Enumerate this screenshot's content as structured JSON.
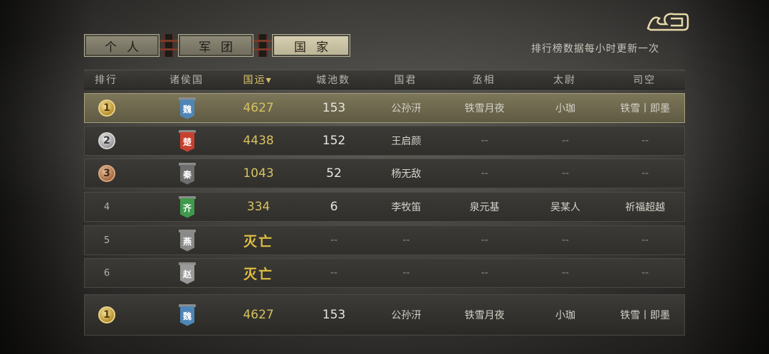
{
  "tabs": [
    "个人",
    "军团",
    "国家"
  ],
  "active_tab": 2,
  "notice": "排行榜数据每小时更新一次",
  "headers": {
    "rank": "排行",
    "state": "诸侯国",
    "luck": "国运▾",
    "cities": "城池数",
    "king": "国君",
    "chancellor": "丞相",
    "taiwei": "太尉",
    "sikong": "司空"
  },
  "rows": [
    {
      "rank": "1",
      "state": "魏",
      "luck": "4627",
      "cities": "153",
      "king": "公孙汧",
      "chancellor": "铁雪月夜",
      "taiwei": "小珈",
      "sikong": "铁雪丨即墨"
    },
    {
      "rank": "2",
      "state": "楚",
      "luck": "4438",
      "cities": "152",
      "king": "王启颜",
      "chancellor": "--",
      "taiwei": "--",
      "sikong": "--"
    },
    {
      "rank": "3",
      "state": "秦",
      "luck": "1043",
      "cities": "52",
      "king": "杨无敌",
      "chancellor": "--",
      "taiwei": "--",
      "sikong": "--"
    },
    {
      "rank": "4",
      "state": "齐",
      "luck": "334",
      "cities": "6",
      "king": "李牧笛",
      "chancellor": "泉元基",
      "taiwei": "吴某人",
      "sikong": "祈福超越"
    },
    {
      "rank": "5",
      "state": "燕",
      "luck": "灭亡",
      "cities": "--",
      "king": "--",
      "chancellor": "--",
      "taiwei": "--",
      "sikong": "--"
    },
    {
      "rank": "6",
      "state": "赵",
      "luck": "灭亡",
      "cities": "--",
      "king": "--",
      "chancellor": "--",
      "taiwei": "--",
      "sikong": "--"
    }
  ],
  "mine": {
    "rank": "1",
    "state": "魏",
    "luck": "4627",
    "cities": "153",
    "king": "公孙汧",
    "chancellor": "铁雪月夜",
    "taiwei": "小珈",
    "sikong": "铁雪丨即墨"
  },
  "colors": {
    "wei": "#4f86b8",
    "chu": "#c8402f",
    "qin": "#6e6e6e",
    "qi": "#3f9a4c",
    "yan": "#8a8a8a",
    "zhao": "#9a9a9a",
    "gold_text": "#d7c25f"
  },
  "icons": {
    "back": "back-arrow-icon"
  }
}
